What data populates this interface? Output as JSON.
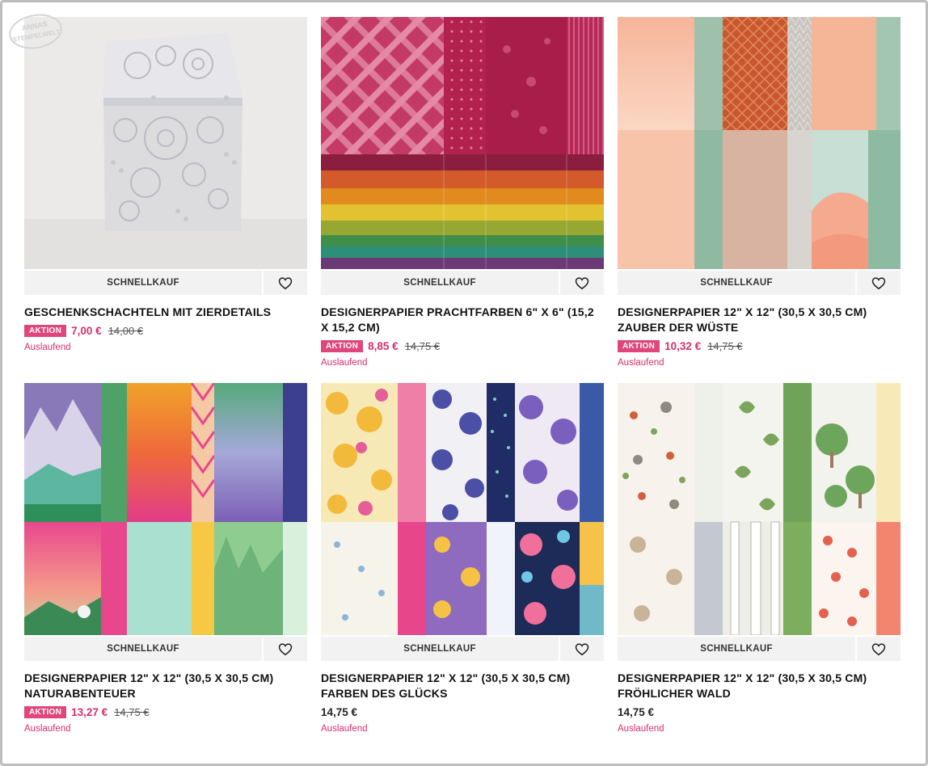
{
  "logo": {
    "text": "ANNAS STEMPELWELT"
  },
  "colors": {
    "accent": "#e0457b",
    "sale_price": "#d62e6f"
  },
  "quick_buy_label": "SCHNELLKAUF",
  "favorite_icon": "heart-icon",
  "products": [
    {
      "title": "GESCHENKSCHACHTELN MIT ZIERDETAILS",
      "badge": "AKTION",
      "sale_price": "7,00 €",
      "old_price": "14,00 €",
      "status": "Auslaufend"
    },
    {
      "title": "DESIGNERPAPIER PRACHTFARBEN 6\" X 6\" (15,2 X 15,2 CM)",
      "badge": "AKTION",
      "sale_price": "8,85 €",
      "old_price": "14,75 €",
      "status": "Auslaufend"
    },
    {
      "title": "DESIGNERPAPIER 12\" X 12\" (30,5 X 30,5 CM) ZAUBER DER WÜSTE",
      "badge": "AKTION",
      "sale_price": "10,32 €",
      "old_price": "14,75 €",
      "status": "Auslaufend"
    },
    {
      "title": "DESIGNERPAPIER 12\" X 12\" (30,5 X 30,5 CM) NATURABENTEUER",
      "badge": "AKTION",
      "sale_price": "13,27 €",
      "old_price": "14,75 €",
      "status": "Auslaufend"
    },
    {
      "title": "DESIGNERPAPIER 12\" X 12\" (30,5 X 30,5 CM) FARBEN DES GLÜCKS",
      "price": "14,75 €",
      "status": "Auslaufend"
    },
    {
      "title": "DESIGNERPAPIER 12\" X 12\" (30,5 X 30,5 CM) FRÖHLICHER WALD",
      "price": "14,75 €",
      "status": "Auslaufend"
    }
  ]
}
